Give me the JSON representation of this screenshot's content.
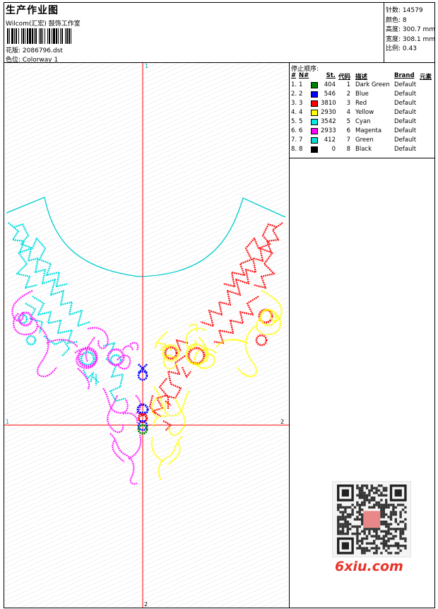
{
  "header": {
    "title": "生产作业图",
    "company": "Wilcom(汇宏) 鼓饰工作室",
    "design_label": "花版:",
    "design_file": "2086796.dst",
    "colorway_label": "色位:",
    "colorway": "Colorway 1"
  },
  "stats": [
    {
      "label": "针数:",
      "value": "14579"
    },
    {
      "label": "颜色:",
      "value": "8"
    },
    {
      "label": "高度:",
      "value": "300.7 mm"
    },
    {
      "label": "宽度:",
      "value": "308.1 mm"
    },
    {
      "label": "比例:",
      "value": "0.43"
    }
  ],
  "stop_sequence": {
    "title": "停止顺序:",
    "headers": {
      "num": "#",
      "n": "N#",
      "st": "St.",
      "code": "代码",
      "desc": "描述",
      "brand": "Brand",
      "element": "元素"
    },
    "rows": [
      {
        "num": "1.",
        "n": "1",
        "st": "404",
        "code": "1",
        "desc": "Dark Green",
        "brand": "Default",
        "color": "#008000"
      },
      {
        "num": "2.",
        "n": "2",
        "st": "546",
        "code": "2",
        "desc": "Blue",
        "brand": "Default",
        "color": "#0000ff"
      },
      {
        "num": "3.",
        "n": "3",
        "st": "3810",
        "code": "3",
        "desc": "Red",
        "brand": "Default",
        "color": "#ff0000"
      },
      {
        "num": "4.",
        "n": "4",
        "st": "2930",
        "code": "4",
        "desc": "Yellow",
        "brand": "Default",
        "color": "#ffff00"
      },
      {
        "num": "5.",
        "n": "5",
        "st": "3542",
        "code": "5",
        "desc": "Cyan",
        "brand": "Default",
        "color": "#00e5e5"
      },
      {
        "num": "6.",
        "n": "6",
        "st": "2933",
        "code": "6",
        "desc": "Magenta",
        "brand": "Default",
        "color": "#ff00ff"
      },
      {
        "num": "7.",
        "n": "7",
        "st": "412",
        "code": "7",
        "desc": "Green",
        "brand": "Default",
        "color": "#00e0d0"
      },
      {
        "num": "8.",
        "n": "8",
        "st": "0",
        "code": "8",
        "desc": "Black",
        "brand": "Default",
        "color": "#000000"
      }
    ]
  },
  "axes": {
    "top_label": "1",
    "left_label": "1",
    "right_label": "2",
    "bottom_label": "2"
  },
  "colors": {
    "guide": "#ff0000",
    "outline": "#00cccc"
  },
  "watermark": "6xiu.com"
}
